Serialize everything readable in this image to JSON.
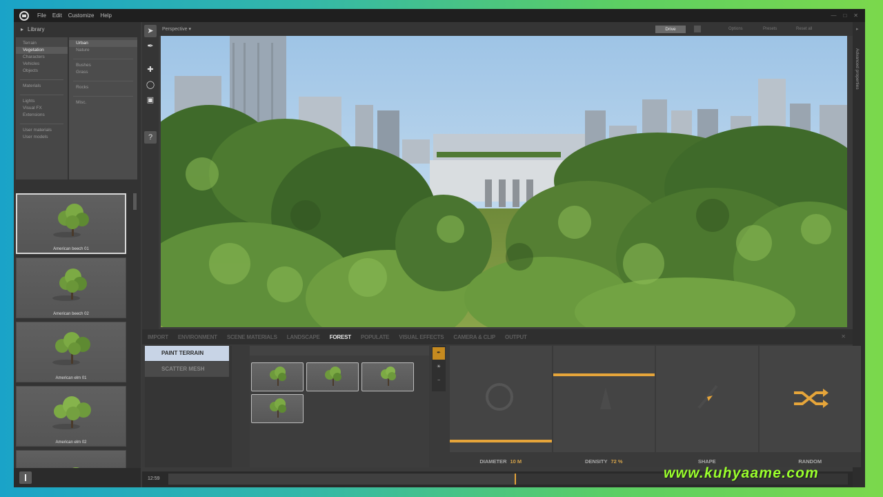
{
  "menubar": {
    "items": [
      "File",
      "Edit",
      "Customize",
      "Help"
    ]
  },
  "library": {
    "title": "Library",
    "categories": [
      "Terrain",
      "Vegetation",
      "Characters",
      "Vehicles",
      "Objects",
      "Materials",
      "Lights",
      "Visual FX",
      "Extensions",
      "User materials",
      "User models"
    ],
    "subcategories": [
      "Urban",
      "Nature",
      "Bushes",
      "Grass",
      "Rocks",
      "Misc."
    ],
    "items": [
      {
        "label": "American beech 01"
      },
      {
        "label": "American beech 02"
      },
      {
        "label": "American elm 01"
      },
      {
        "label": "American elm 02"
      },
      {
        "label": ""
      }
    ]
  },
  "viewport": {
    "camera_mode": "Perspective",
    "drive_label": "Drive",
    "options": [
      "Options",
      "Presets",
      "Reset all"
    ]
  },
  "right_panel": {
    "label": "Advanced properties"
  },
  "bottom": {
    "tabs": [
      "IMPORT",
      "ENVIRONMENT",
      "SCENE MATERIALS",
      "LANDSCAPE",
      "FOREST",
      "POPULATE",
      "VISUAL EFFECTS",
      "CAMERA & CLIP",
      "OUTPUT"
    ],
    "active_tab": "FOREST",
    "modes": [
      "PAINT TERRAIN",
      "SCATTER MESH"
    ],
    "params": {
      "diameter_label": "DIAMETER",
      "diameter_value": "10 M",
      "density_label": "DENSITY",
      "density_value": "72 %",
      "shape_label": "SHAPE",
      "random_label": "RANDOM"
    }
  },
  "timeline": {
    "time": "12:59",
    "progress": 0.51
  },
  "watermark": "www.kuhyaame.com",
  "colors": {
    "accent": "#e6a53a",
    "panel": "#3b3b3b",
    "selected_mode": "#c8d4e6"
  }
}
